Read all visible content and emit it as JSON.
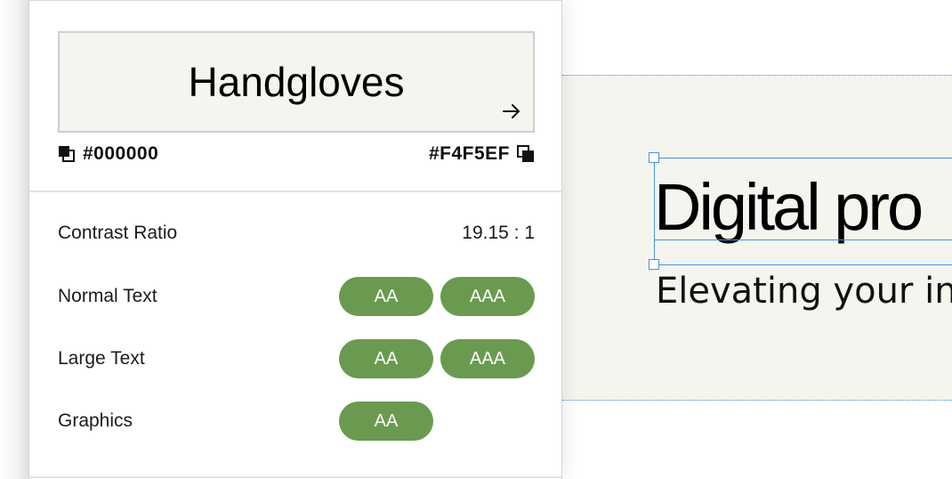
{
  "canvas": {
    "heading": "Digital pro",
    "subheading": "Elevating your in",
    "background_color": "#F4F5EF",
    "selection_color": "#4a90e2"
  },
  "panel": {
    "preview": {
      "sample_text": "Handgloves",
      "swap_icon": "arrow-right-icon"
    },
    "foreground": {
      "hex": "#000000",
      "icon": "foreground-swatch-icon"
    },
    "background": {
      "hex": "#F4F5EF",
      "icon": "background-swatch-icon"
    },
    "contrast": {
      "label": "Contrast Ratio",
      "value": "19.15 : 1"
    },
    "checks": [
      {
        "label": "Normal Text",
        "aa": "AA",
        "aaa": "AAA"
      },
      {
        "label": "Large Text",
        "aa": "AA",
        "aaa": "AAA"
      },
      {
        "label": "Graphics",
        "aa": "AA"
      }
    ],
    "pass_color": "#6A9A50"
  }
}
